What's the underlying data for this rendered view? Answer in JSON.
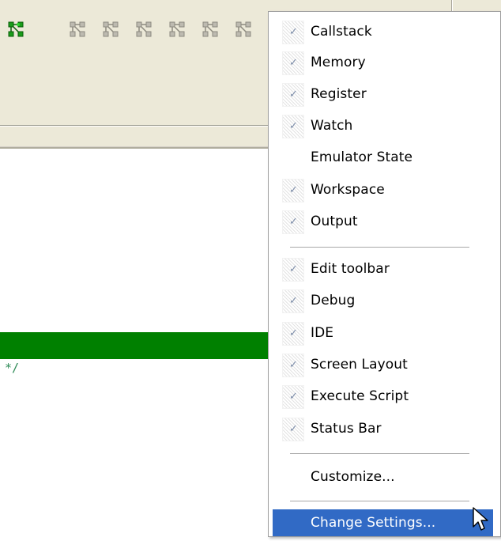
{
  "toolbar": {
    "icons": [
      "network-active-icon",
      "network-icon",
      "network-icon",
      "network-icon",
      "network-icon",
      "network-icon"
    ]
  },
  "editor": {
    "comment_fragment": "*/",
    "highlight_color": "#008000"
  },
  "menu": {
    "items": [
      {
        "label": "Callstack",
        "checked": true
      },
      {
        "label": "Memory",
        "checked": true
      },
      {
        "label": "Register",
        "checked": true
      },
      {
        "label": "Watch",
        "checked": true
      },
      {
        "label": "Emulator State",
        "checked": false
      },
      {
        "label": "Workspace",
        "checked": true
      },
      {
        "label": "Output",
        "checked": true
      },
      {
        "label": "Edit toolbar",
        "checked": true
      },
      {
        "label": "Debug",
        "checked": true
      },
      {
        "label": "IDE",
        "checked": true
      },
      {
        "label": "Screen Layout",
        "checked": true
      },
      {
        "label": "Execute Script",
        "checked": true
      },
      {
        "label": "Status Bar",
        "checked": true
      },
      {
        "label": "Customize...",
        "checked": false
      },
      {
        "label": "Change Settings...",
        "checked": false,
        "selected": true
      }
    ],
    "check_glyph": "✓",
    "selection_color": "#316ac5"
  }
}
